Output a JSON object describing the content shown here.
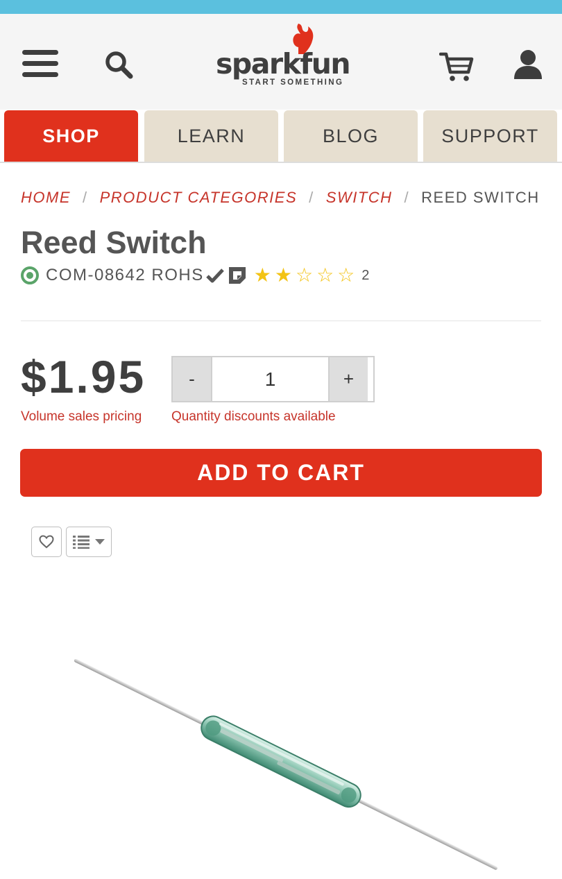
{
  "colors": {
    "accent_red": "#e0311d",
    "link_red": "#c6342a",
    "tab_bg": "#e7dfd0",
    "top_strip": "#5bc0de",
    "header_bg": "#f5f5f5",
    "star_gold": "#f3c314",
    "in_stock_green": "#5aa469"
  },
  "header": {
    "logo": {
      "word": "sparkfun",
      "tagline": "START SOMETHING"
    },
    "icons": [
      "menu-icon",
      "search-icon",
      "cart-icon",
      "account-icon"
    ]
  },
  "tabs": [
    {
      "label": "SHOP",
      "active": true
    },
    {
      "label": "LEARN",
      "active": false
    },
    {
      "label": "BLOG",
      "active": false
    },
    {
      "label": "SUPPORT",
      "active": false
    }
  ],
  "breadcrumb": {
    "items": [
      "HOME",
      "PRODUCT CATEGORIES",
      "SWITCH",
      "REED SWITCH"
    ],
    "separator": "/"
  },
  "product": {
    "title": "Reed Switch",
    "sku": "COM-08642 ROHS",
    "stock_icon": "in-stock-icon",
    "rating": {
      "filled": 2,
      "max": 5,
      "review_count": "2"
    },
    "price": "$1.95",
    "volume_pricing_link": "Volume sales pricing",
    "quantity": {
      "minus": "-",
      "value": "1",
      "plus": "+",
      "discount_link": "Quantity discounts available"
    },
    "add_to_cart": "ADD TO CART",
    "image_subject": "glass reed switch with two leads"
  }
}
